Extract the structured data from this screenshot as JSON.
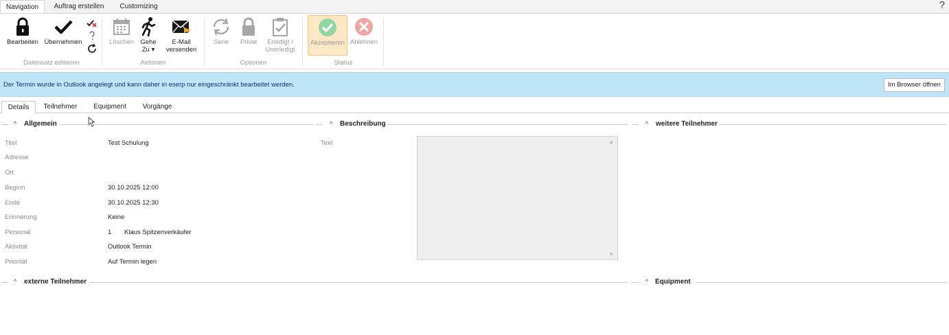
{
  "ribbon_tabs": [
    {
      "label": "Navigation",
      "active": true
    },
    {
      "label": "Auftrag erstellen",
      "active": false
    },
    {
      "label": "Customizing",
      "active": false
    }
  ],
  "help_label": "?",
  "ribbon": {
    "bearbeiten": "Bearbeiten",
    "uebernehmen": "Übernehmen",
    "loeschen": "Löschen",
    "gehe_zu_1": "Gehe",
    "gehe_zu_2": "Zu ▾",
    "email_1": "E-Mail",
    "email_2": "versenden",
    "serie": "Serie",
    "privat": "Privat",
    "erledigt_1": "Erledigt /",
    "erledigt_2": "Unerledigt",
    "akzeptieren": "Akzeptieren",
    "ablehnen": "Ablehnen",
    "groups": {
      "datensatz": "Datensatz editieren",
      "aktionen": "Aktionen",
      "optionen": "Optionen",
      "status": "Status"
    }
  },
  "infobar": {
    "message": "Der Termin wurde in Outlook angelegt und kann daher in eserp nur eingeschränkt bearbeitet werden.",
    "button": "Im Browser öffnen"
  },
  "detail_tabs": [
    {
      "label": "Details",
      "active": true
    },
    {
      "label": "Teilnehmer",
      "active": false
    },
    {
      "label": "Equipment",
      "active": false
    },
    {
      "label": "Vorgänge",
      "active": false
    }
  ],
  "sections": {
    "allgemein": "Allgemein",
    "beschreibung": "Beschreibung",
    "weitere_teilnehmer": "weitere Teilnehmer",
    "externe_teilnehmer": "externe Teilnehmer",
    "equipment": "Equipment"
  },
  "fields": {
    "titel": {
      "label": "Titel",
      "value": "Test Schulung"
    },
    "adresse": {
      "label": "Adresse",
      "value": ""
    },
    "ort": {
      "label": "Ort",
      "value": ""
    },
    "beginn": {
      "label": "Beginn",
      "value": "30.10.2025 12:00"
    },
    "ende": {
      "label": "Ende",
      "value": "30.10.2025 12:30"
    },
    "erinnerung": {
      "label": "Erinnerung",
      "value": "Keine"
    },
    "personal": {
      "label": "Personal",
      "id": "1",
      "value": "Klaus Spitzenverkäufer"
    },
    "aktivitaet": {
      "label": "Aktivität",
      "value": "Outlook Termin"
    },
    "prioritaet": {
      "label": "Priorität",
      "value": "Auf Termin legen"
    }
  },
  "beschreibung_text_label": "Text",
  "colors": {
    "infobar_bg": "#bfe5f8",
    "accept_green": "#5cc37a",
    "reject_red": "#e9797b",
    "pressed_bg": "#fde7c4"
  },
  "icons": [
    "lock-icon",
    "check-icon",
    "check-x-icon",
    "question-icon",
    "refresh-icon",
    "calendar-icon",
    "running-man-icon",
    "email-icon",
    "repeat-icon",
    "padlock-icon",
    "clipboard-check-icon",
    "accept-icon",
    "reject-icon",
    "chevron-up-icon",
    "mouse-cursor-icon"
  ]
}
